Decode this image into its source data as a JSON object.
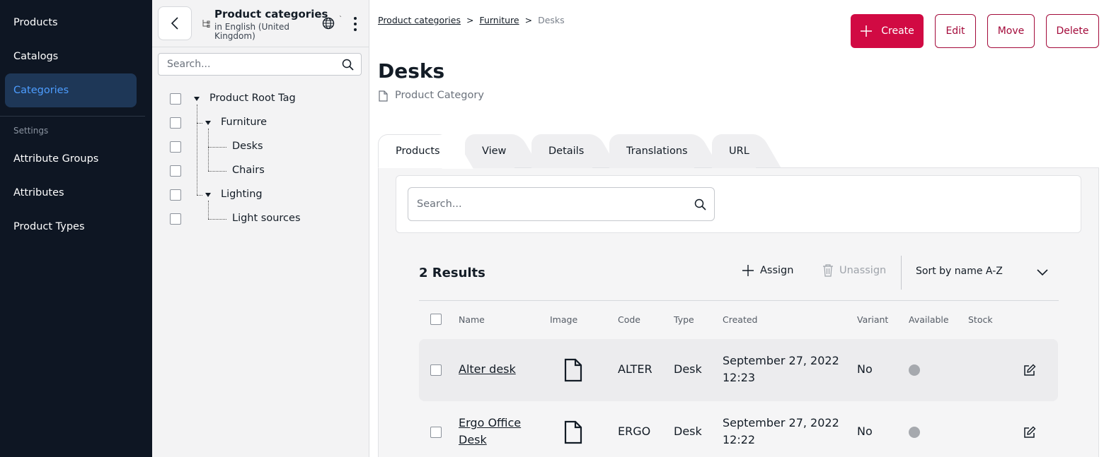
{
  "nav": {
    "items": [
      "Products",
      "Catalogs",
      "Categories"
    ],
    "section_label": "Settings",
    "settings_items": [
      "Attribute Groups",
      "Attributes",
      "Product Types"
    ]
  },
  "tree": {
    "title": "Product categories",
    "subtitle": "in English (United Kingdom)",
    "search_placeholder": "Search...",
    "nodes": [
      "Product Root Tag",
      "Furniture",
      "Desks",
      "Chairs",
      "Lighting",
      "Light sources"
    ],
    "globe_suffix": "`"
  },
  "breadcrumb": {
    "items": [
      "Product categories",
      "Furniture",
      "Desks"
    ],
    "separator": ">"
  },
  "actions": {
    "create": "Create",
    "edit": "Edit",
    "move": "Move",
    "delete": "Delete"
  },
  "header": {
    "title": "Desks",
    "subtitle": "Product Category"
  },
  "tabs": [
    "Products",
    "View",
    "Details",
    "Translations",
    "URL"
  ],
  "products": {
    "search_placeholder": "Search...",
    "results_label": "2 Results",
    "assign": "Assign",
    "unassign": "Unassign",
    "sort": "Sort by name A-Z",
    "columns": [
      "Name",
      "Image",
      "Code",
      "Type",
      "Created",
      "Variant",
      "Available",
      "Stock"
    ],
    "rows": [
      {
        "name": "Alter desk",
        "code": "ALTER",
        "type": "Desk",
        "created_date": "September 27, 2022",
        "created_time": "12:23",
        "variant": "No"
      },
      {
        "name_line1": "Ergo Office",
        "name_line2": "Desk",
        "code": "ERGO",
        "type": "Desk",
        "created_date": "September 27, 2022",
        "created_time": "12:22",
        "variant": "No"
      }
    ]
  },
  "colors": {
    "nav_bg": "#0e1623",
    "nav_active_bg": "#1e3757",
    "nav_active_text": "#4d9dff",
    "primary": "#d10a43",
    "outline": "#a30a3a"
  }
}
